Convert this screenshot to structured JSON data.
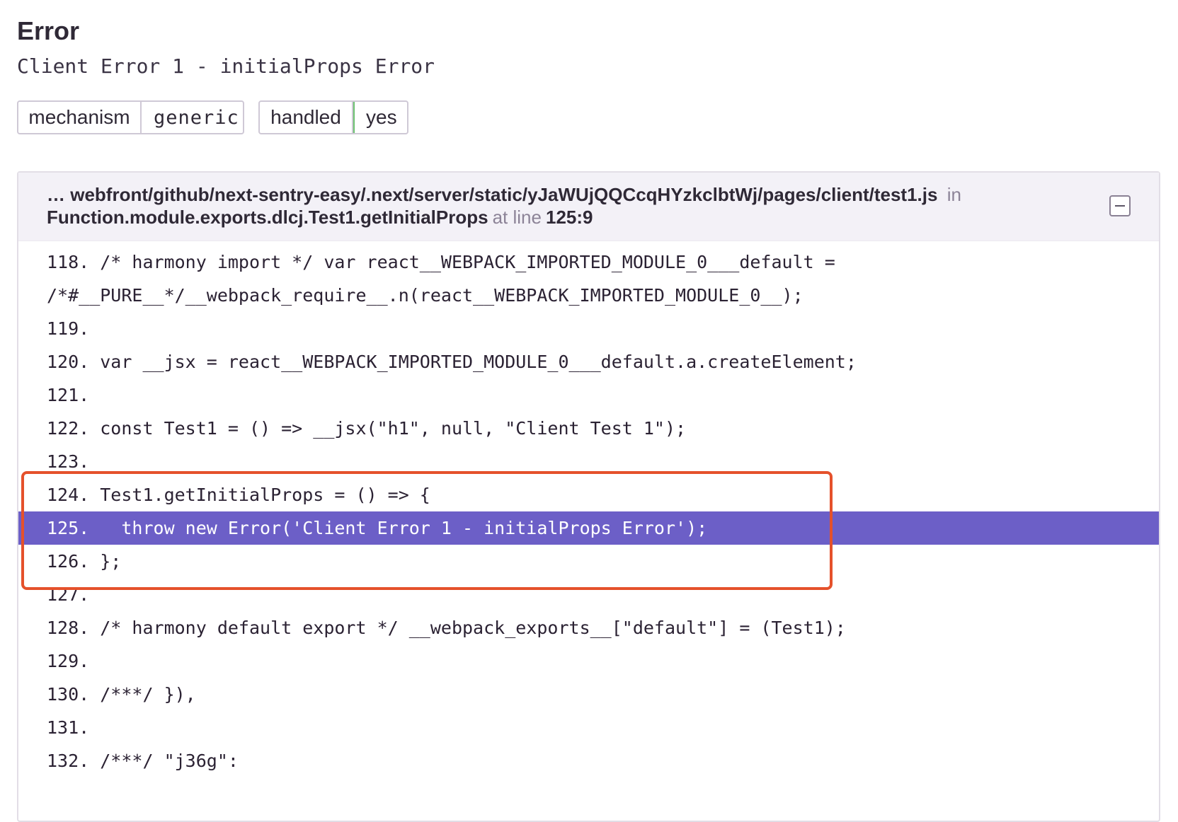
{
  "error": {
    "title": "Error",
    "message": "Client Error 1 - initialProps Error"
  },
  "tags": [
    {
      "key": "mechanism",
      "value": "generic"
    },
    {
      "key": "handled",
      "value": "yes"
    }
  ],
  "frame": {
    "path": "… webfront/github/next-sentry-easy/.next/server/static/yJaWUjQQCcqHYzkclbtWj/pages/client/test1.js",
    "in_label": "in",
    "function": "Function.module.exports.dlcj.Test1.getInitialProps",
    "at_line_label": "at line",
    "position": "125:9",
    "collapse_icon": "minus-square-icon"
  },
  "code_lines": [
    {
      "text": "118. /* harmony import */ var react__WEBPACK_IMPORTED_MODULE_0___default ="
    },
    {
      "text": "/*#__PURE__*/__webpack_require__.n(react__WEBPACK_IMPORTED_MODULE_0__);"
    },
    {
      "text": "119."
    },
    {
      "text": "120. var __jsx = react__WEBPACK_IMPORTED_MODULE_0___default.a.createElement;"
    },
    {
      "text": "121."
    },
    {
      "text": "122. const Test1 = () => __jsx(\"h1\", null, \"Client Test 1\");"
    },
    {
      "text": "123."
    },
    {
      "text": "124. Test1.getInitialProps = () => {"
    },
    {
      "text": "125.   throw new Error('Client Error 1 - initialProps Error');"
    },
    {
      "text": "126. };"
    },
    {
      "text": "127."
    },
    {
      "text": "128. /* harmony default export */ __webpack_exports__[\"default\"] = (Test1);"
    },
    {
      "text": "129."
    },
    {
      "text": "130. /***/ }),"
    },
    {
      "text": "131."
    },
    {
      "text": "132. /***/ \"j36g\":"
    }
  ],
  "colors": {
    "active_line": "#6c5fc7",
    "annotation_box": "#e5512b",
    "handled_yes_border": "#6bc06f"
  }
}
